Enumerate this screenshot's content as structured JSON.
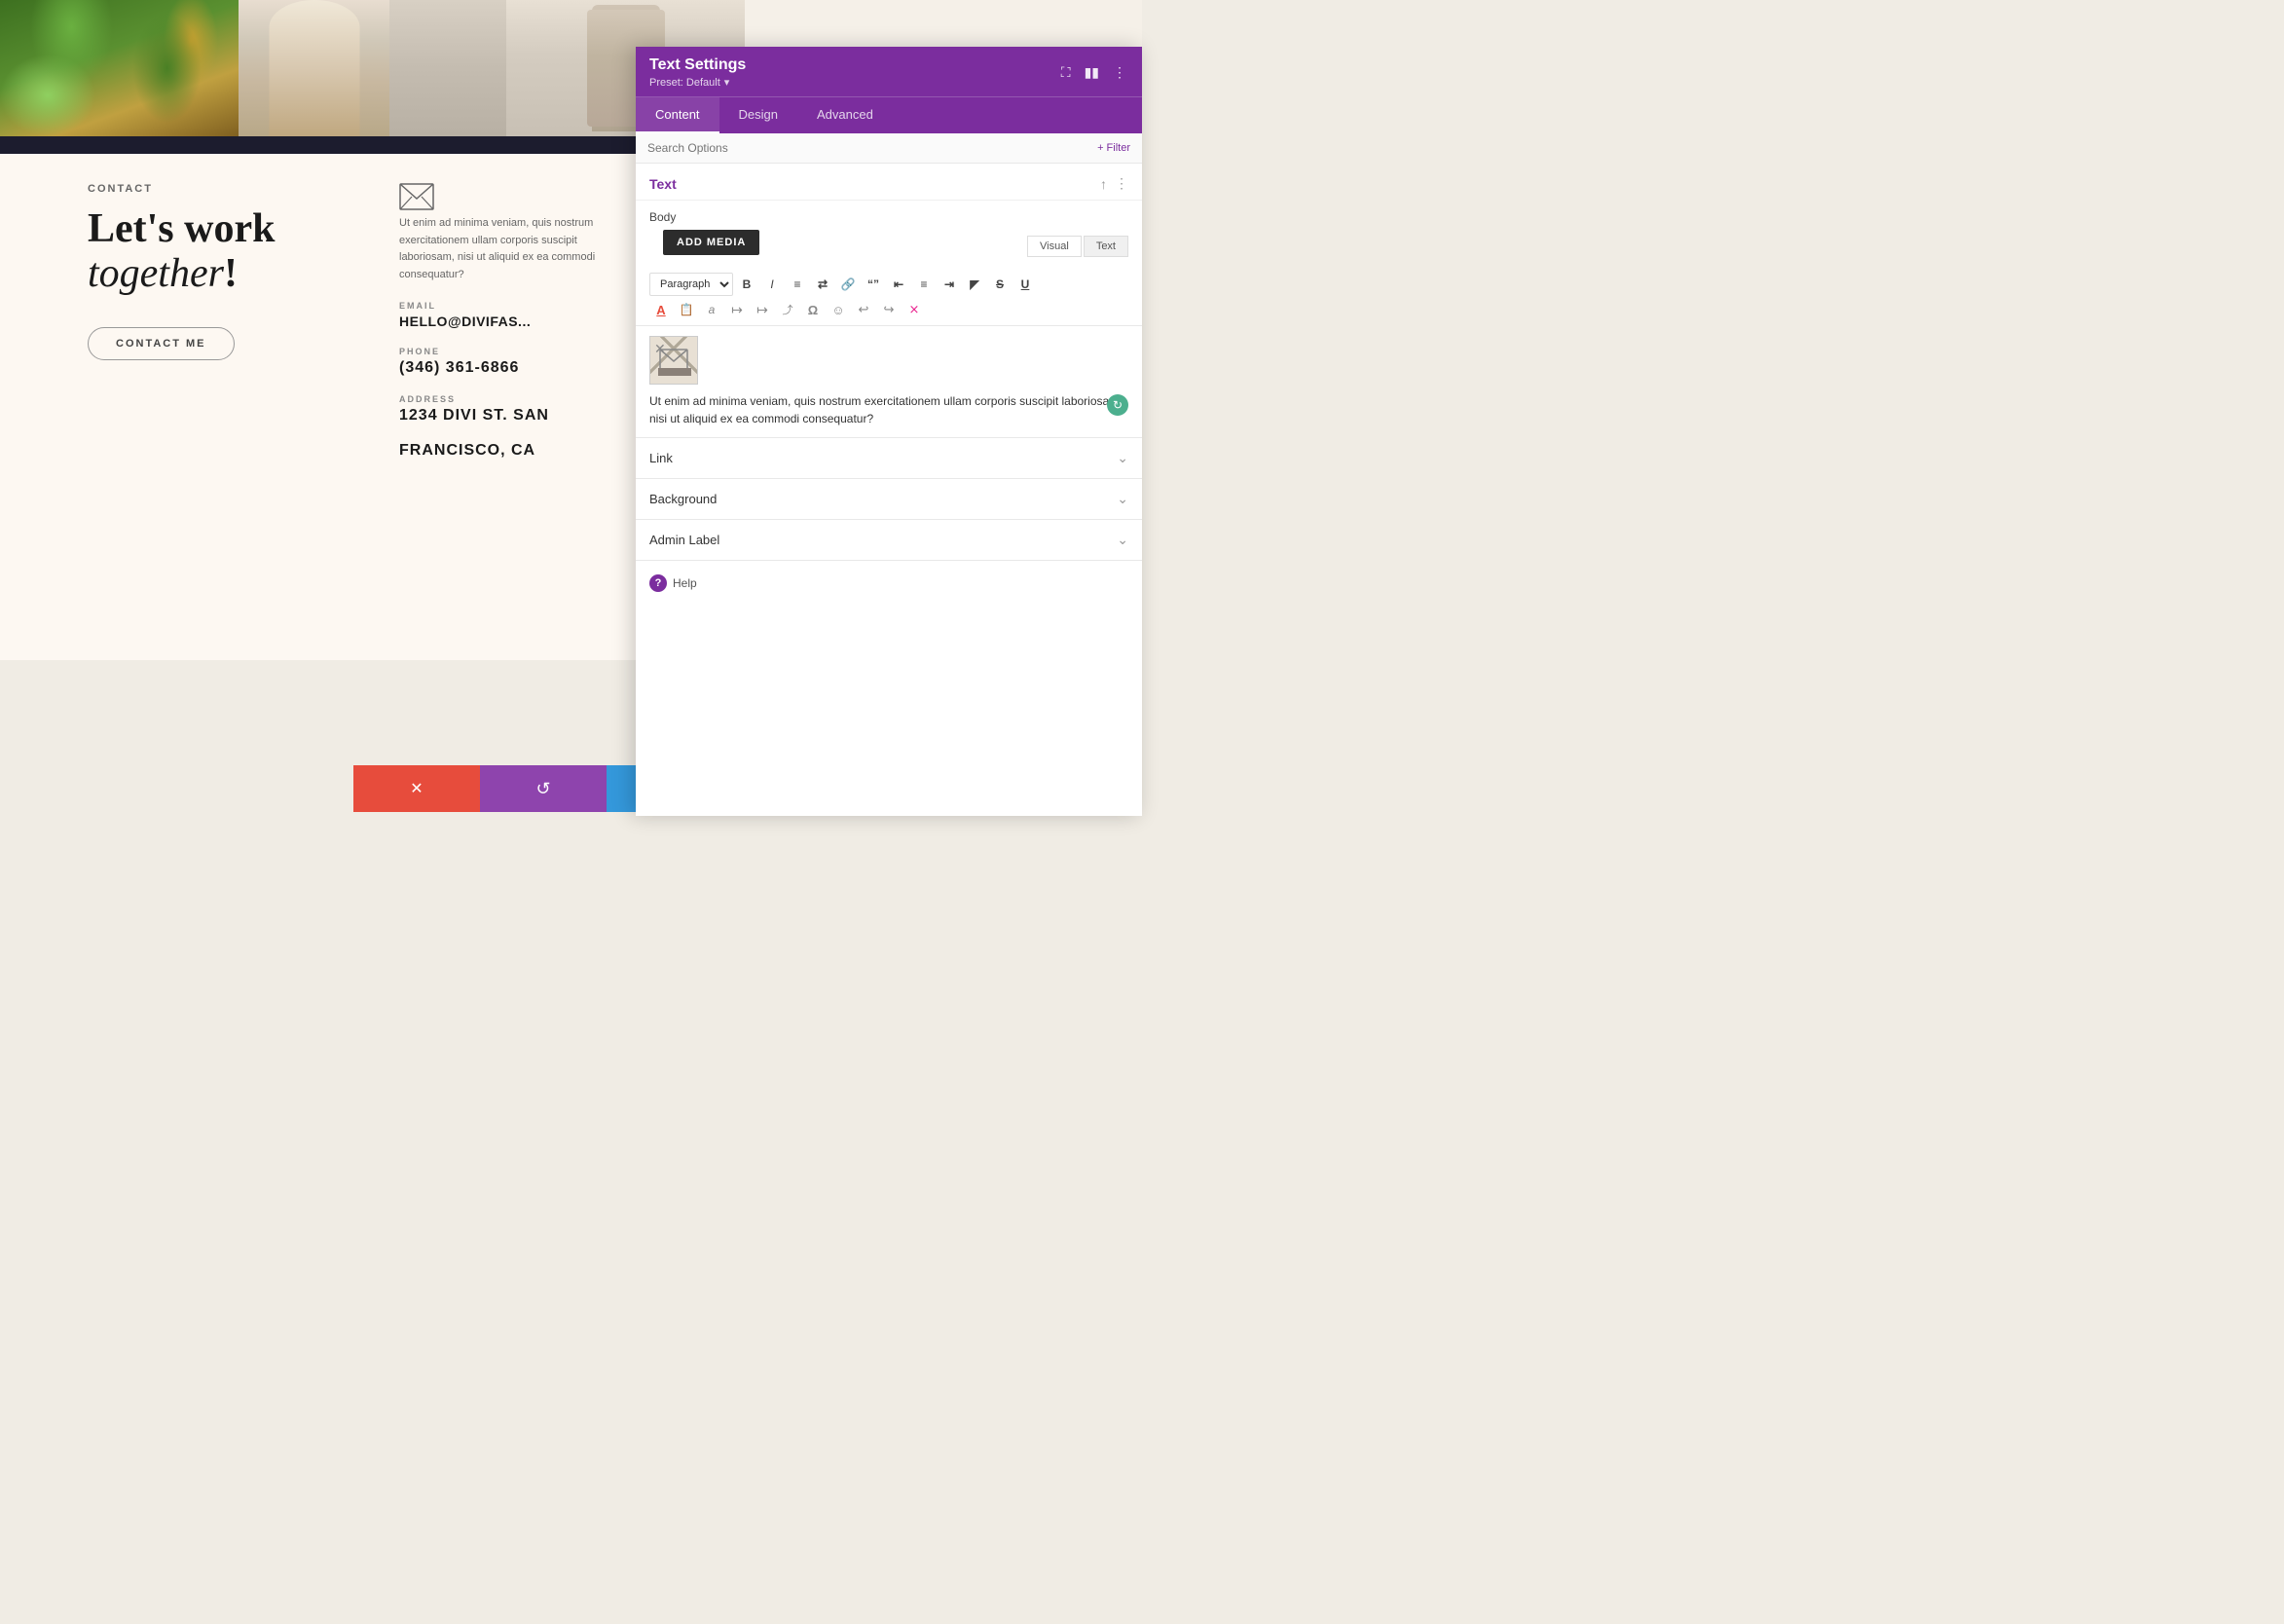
{
  "page": {
    "background_color": "#f0ece4"
  },
  "gallery": {
    "items": [
      {
        "id": "leaf",
        "type": "leaf-image"
      },
      {
        "id": "building",
        "type": "building-image"
      },
      {
        "id": "fashion",
        "type": "fashion-image"
      },
      {
        "id": "model",
        "type": "model-image"
      }
    ]
  },
  "contact_section": {
    "label": "CONTACT",
    "heading_line1": "Let's work",
    "heading_line2": "together",
    "heading_punctuation": "!",
    "button_text": "CONTACT ME",
    "body_text": "Ut enim ad minima veniam, quis nostrum exercitationem ullam corporis suscipit laboriosam, nisi ut aliquid ex ea commodi consequatur?",
    "email_label": "EMAIL",
    "email_value": "HELLO@DIVIFAS...",
    "phone_label": "PHONE",
    "phone_value": "(346) 361-6866",
    "address_label": "ADDRESS",
    "address_line1": "1234 DIVI ST. SAN",
    "address_line2": "FRANCISCO, CA"
  },
  "settings_panel": {
    "title": "Text Settings",
    "preset_label": "Preset: Default",
    "preset_arrow": "▾",
    "tabs": [
      "Content",
      "Design",
      "Advanced"
    ],
    "active_tab": "Content",
    "search_placeholder": "Search Options",
    "filter_label": "+ Filter",
    "section_title": "Text",
    "body_label": "Body",
    "add_media_label": "ADD MEDIA",
    "view_options": [
      "Visual",
      "Text"
    ],
    "active_view": "Text",
    "toolbar": {
      "paragraph_label": "Paragraph",
      "row1_btns": [
        "B",
        "I",
        "≡",
        "≡≡",
        "🔗",
        "\"\"",
        "≡",
        "≡",
        "≡",
        "⊞",
        "⊟"
      ],
      "row2_btns": [
        "A",
        "📋",
        "𝑎",
        "←→",
        "→←",
        "⤢",
        "Ω",
        "☺",
        "↩",
        "↪",
        "🔗"
      ]
    },
    "editor_text": "Ut enim ad minima veniam, quis nostrum exercitationem ullam corporis suscipit laboriosam, nisi ut aliquid ex ea commodi consequatur?",
    "collapsible_sections": [
      "Link",
      "Background",
      "Admin Label"
    ],
    "help_text": "Help",
    "action_bar": {
      "cancel_icon": "✕",
      "reset_icon": "↺",
      "redo_icon": "↻",
      "save_icon": "✓"
    }
  },
  "scroll_indicator": {
    "symbol": "↗"
  }
}
